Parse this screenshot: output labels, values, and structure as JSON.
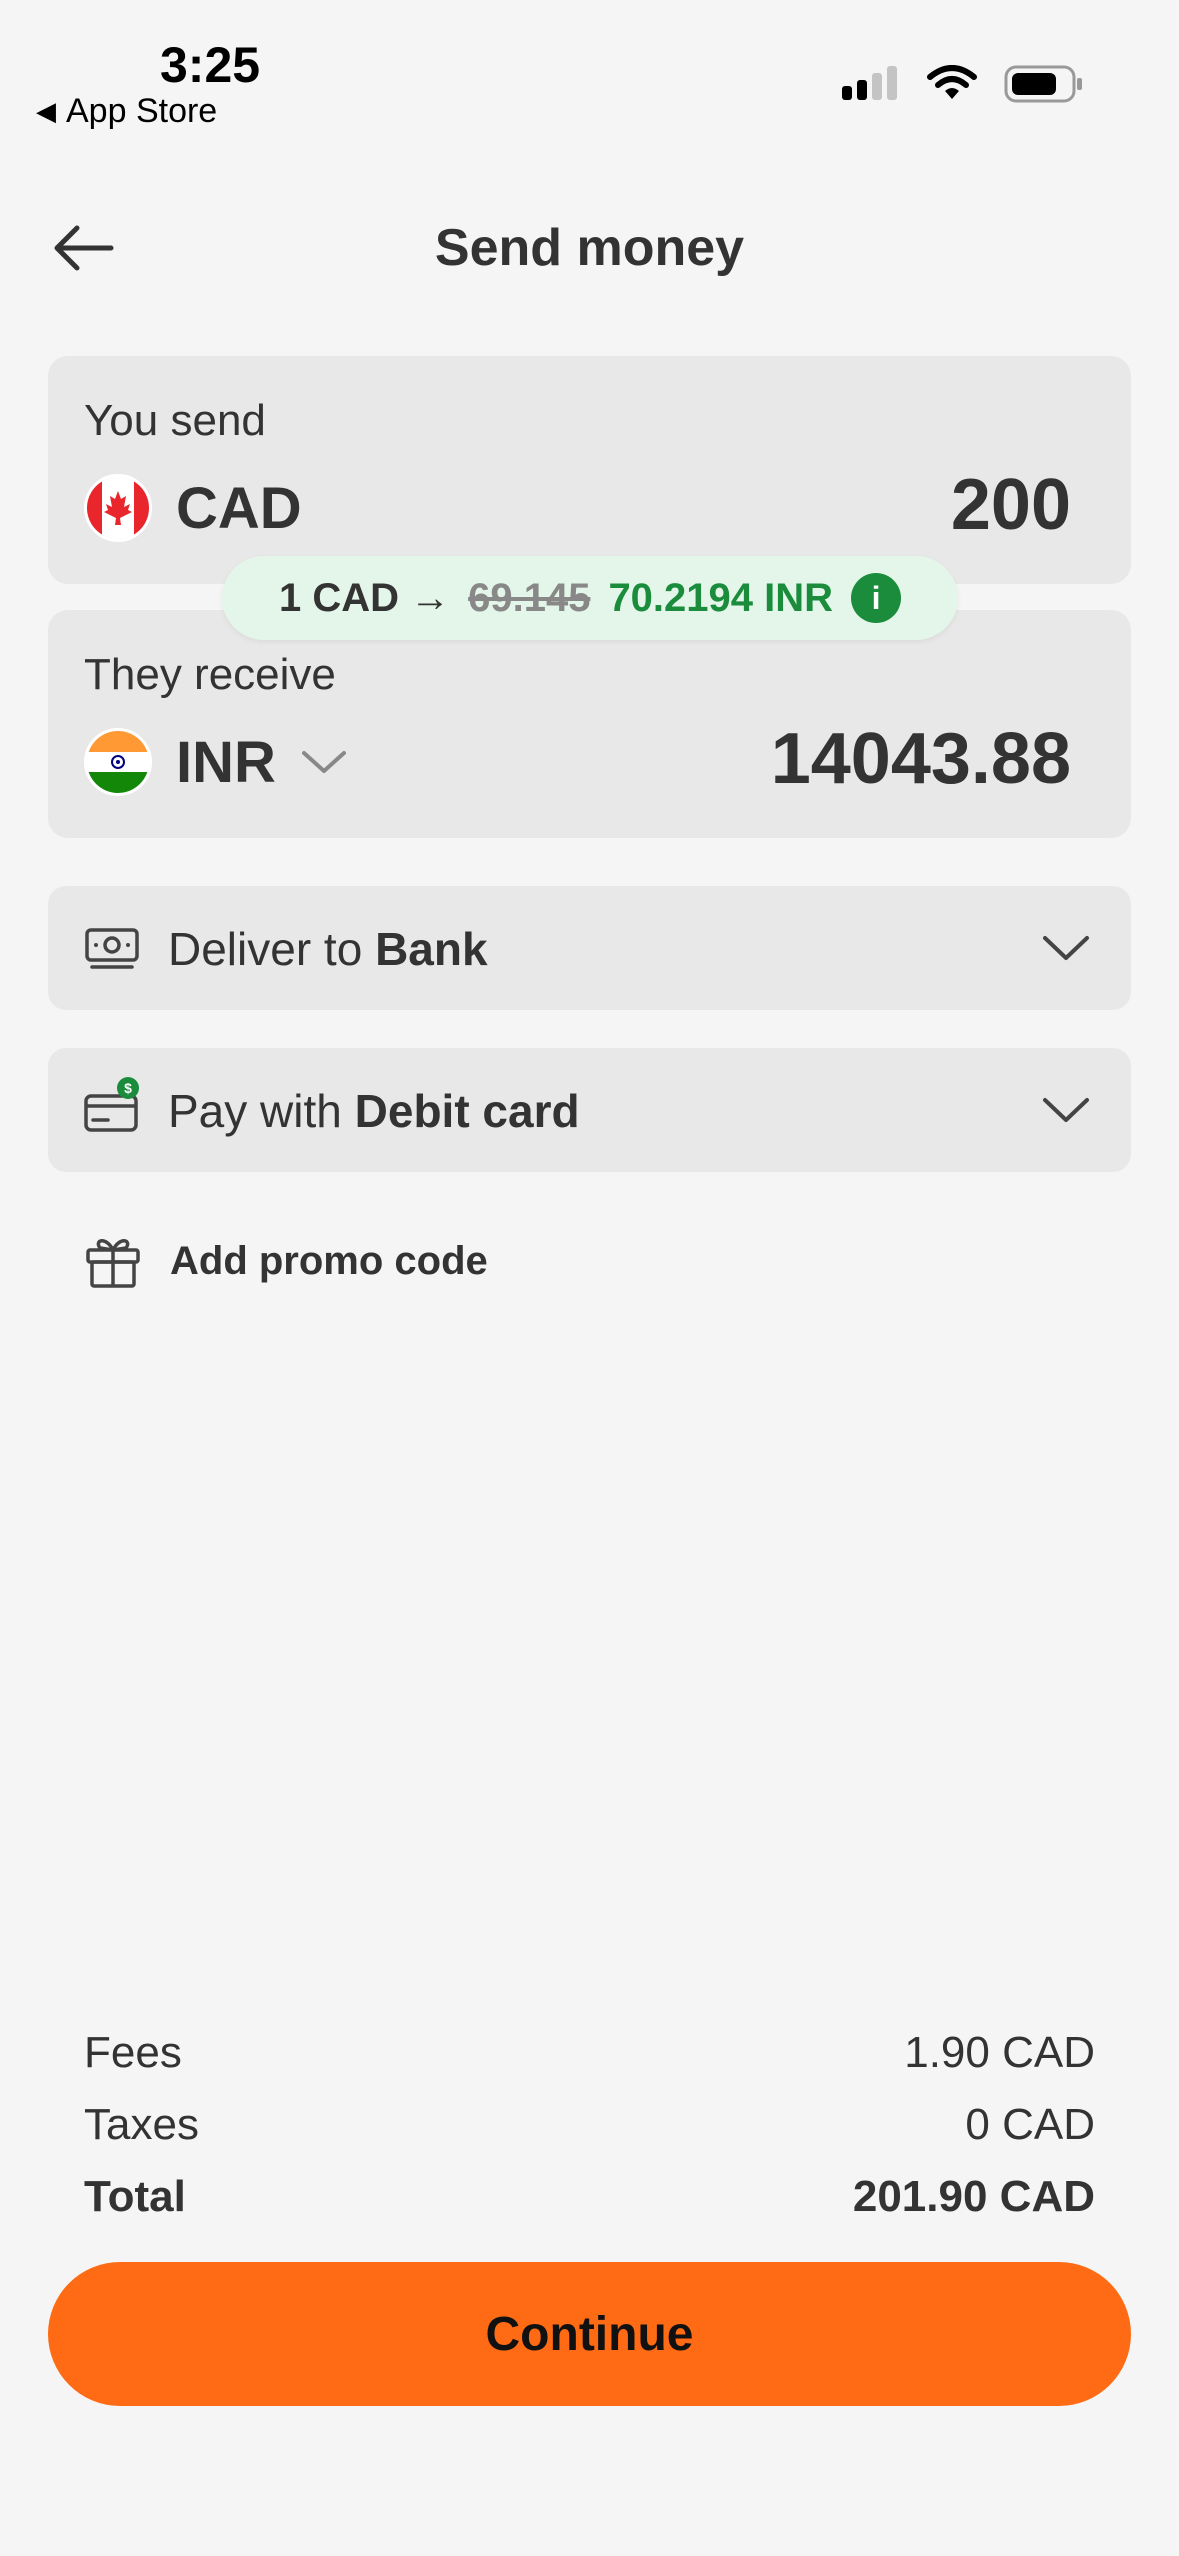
{
  "status_bar": {
    "time": "3:25",
    "back_app": "App Store",
    "icons": [
      "signal-icon",
      "wifi-icon",
      "battery-icon"
    ]
  },
  "header": {
    "title": "Send money",
    "back_icon": "arrow-left-icon"
  },
  "send": {
    "label": "You send",
    "currency": "CAD",
    "amount": "200",
    "flag": "canada-flag"
  },
  "rate": {
    "from": "1 CAD →",
    "old_rate": "69.145",
    "new_rate": "70.2194 INR",
    "info_icon": "info-icon",
    "info_glyph": "i",
    "accent_color": "#1a8c3c",
    "pill_color": "#e3f6e9"
  },
  "receive": {
    "label": "They receive",
    "currency": "INR",
    "amount": "14043.88",
    "flag": "india-flag"
  },
  "deliver": {
    "prefix": "Deliver to",
    "value": "Bank",
    "icon": "cash-icon"
  },
  "pay": {
    "prefix": "Pay with",
    "value": "Debit card",
    "icon": "card-icon"
  },
  "promo": {
    "label": "Add promo code",
    "icon": "gift-icon"
  },
  "summary": {
    "fees_label": "Fees",
    "fees_value": "1.90 CAD",
    "taxes_label": "Taxes",
    "taxes_value": "0 CAD",
    "total_label": "Total",
    "total_value": "201.90 CAD"
  },
  "continue_label": "Continue",
  "colors": {
    "brand_orange": "#ff6b14",
    "background": "#f5f5f5",
    "card": "#e8e8e8"
  }
}
